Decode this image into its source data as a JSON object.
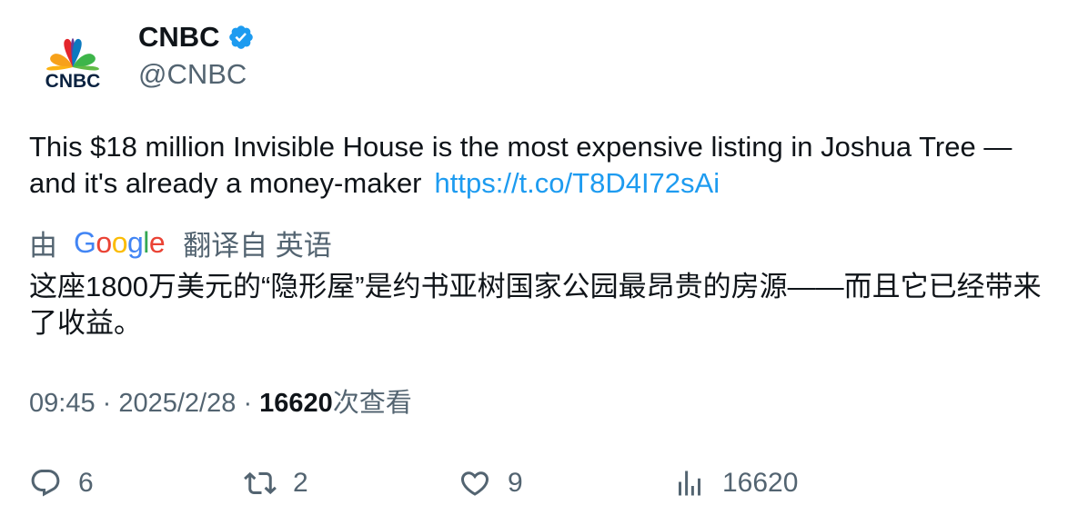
{
  "author": {
    "name": "CNBC",
    "handle": "@CNBC",
    "logo_text": "CNBC",
    "verified": true,
    "verified_color": "#1d9bf0"
  },
  "tweet": {
    "text": "This $18 million Invisible House is the most expensive listing in Joshua Tree — and it's already a money-maker",
    "link": "https://t.co/T8D4I72sAi"
  },
  "translation": {
    "prefix": "由",
    "provider": "Google",
    "suffix": "翻译自 英语",
    "text": "这座1800万美元的“隐形屋”是约书亚树国家公园最昂贵的房源——而且它已经带来了收益。"
  },
  "meta": {
    "time": "09:45",
    "separator": "·",
    "date": "2025/2/28",
    "views_count": "16620",
    "views_label": "次查看"
  },
  "actions": {
    "replies": "6",
    "retweets": "2",
    "likes": "9",
    "views": "16620"
  },
  "colors": {
    "text": "#0f1419",
    "secondary": "#536471",
    "link": "#1d9bf0"
  }
}
